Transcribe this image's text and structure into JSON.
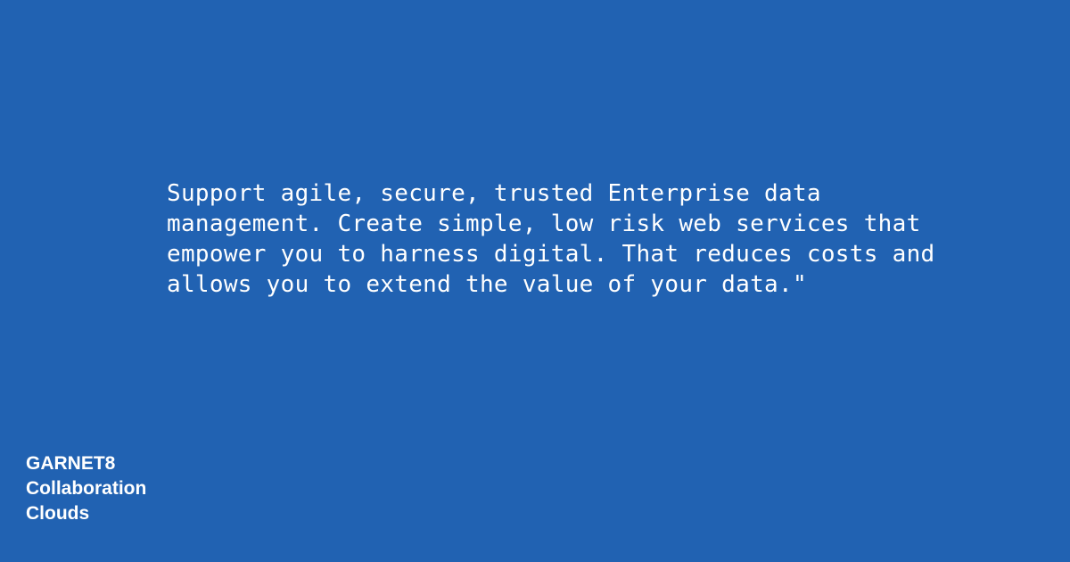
{
  "colors": {
    "background": "#2162b2",
    "text": "#ffffff"
  },
  "quote": {
    "text": "Support agile, secure, trusted Enterprise data\nmanagement. Create simple, low risk web services that\nempower you to harness digital. That reduces costs and\nallows you to extend the value of your data.\""
  },
  "brand": {
    "lines": [
      "GARNET8",
      "Collaboration",
      "Clouds"
    ]
  }
}
